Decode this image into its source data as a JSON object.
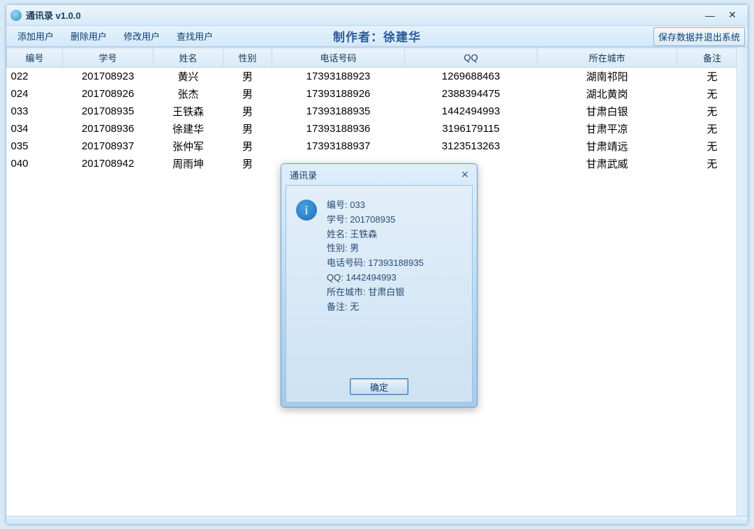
{
  "window": {
    "title": "通讯录  v1.0.0"
  },
  "toolbar": {
    "add_user": "添加用户",
    "delete_user": "删除用户",
    "modify_user": "修改用户",
    "find_user": "查找用户",
    "credit": "制作者：徐建华",
    "save_exit": "保存数据并退出系统"
  },
  "columns": {
    "id": "编号",
    "stu_no": "学号",
    "name": "姓名",
    "gender": "性别",
    "phone": "电话号码",
    "qq": "QQ",
    "city": "所在城市",
    "remark": "备注"
  },
  "rows": [
    {
      "id": "022",
      "stu_no": "201708923",
      "name": "黄兴",
      "gender": "男",
      "phone": "17393188923",
      "qq": "1269688463",
      "city": "湖南祁阳",
      "remark": "无"
    },
    {
      "id": "024",
      "stu_no": "201708926",
      "name": "张杰",
      "gender": "男",
      "phone": "17393188926",
      "qq": "2388394475",
      "city": "湖北黄岗",
      "remark": "无"
    },
    {
      "id": "033",
      "stu_no": "201708935",
      "name": "王铁森",
      "gender": "男",
      "phone": "17393188935",
      "qq": "1442494993",
      "city": "甘肃白银",
      "remark": "无"
    },
    {
      "id": "034",
      "stu_no": "201708936",
      "name": "徐建华",
      "gender": "男",
      "phone": "17393188936",
      "qq": "3196179115",
      "city": "甘肃平凉",
      "remark": "无"
    },
    {
      "id": "035",
      "stu_no": "201708937",
      "name": "张仲军",
      "gender": "男",
      "phone": "17393188937",
      "qq": "3123513263",
      "city": "甘肃靖远",
      "remark": "无"
    },
    {
      "id": "040",
      "stu_no": "201708942",
      "name": "周雨坤",
      "gender": "男",
      "phone": "",
      "qq": "",
      "city": "甘肃武威",
      "remark": "无"
    }
  ],
  "dialog": {
    "title": "通讯录",
    "labels": {
      "id": "编号:",
      "stu_no": "学号:",
      "name": "姓名:",
      "gender": "性别:",
      "phone": "电话号码:",
      "qq": "QQ:",
      "city": "所在城市:",
      "remark": "备注:"
    },
    "values": {
      "id": "033",
      "stu_no": "201708935",
      "name": "王铁森",
      "gender": "男",
      "phone": "17393188935",
      "qq": "1442494993",
      "city": "甘肃白银",
      "remark": "无"
    },
    "ok": "确定"
  }
}
